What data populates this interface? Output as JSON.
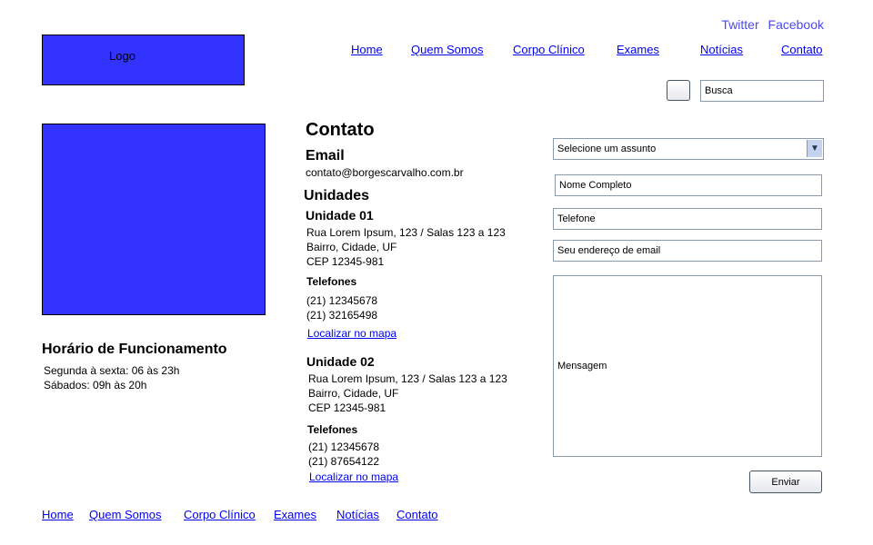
{
  "social": {
    "twitter": "Twitter",
    "facebook": "Facebook"
  },
  "logo": {
    "label": "Logo"
  },
  "nav": [
    "Home",
    "Quem Somos",
    "Corpo Clínico",
    "Exames",
    "Notícias",
    "Contato"
  ],
  "search": {
    "placeholder": "Busca"
  },
  "hours": {
    "title": "Horário de Funcionamento",
    "lines": [
      "Segunda à sexta: 06 às 23h",
      "Sábados: 09h às 20h"
    ]
  },
  "contact": {
    "title": "Contato",
    "email_heading": "Email",
    "email": "contato@borgescarvalho.com.br",
    "units_heading": "Unidades",
    "units": [
      {
        "name": "Unidade 01",
        "address": [
          "Rua Lorem Ipsum, 123 / Salas 123 a 123",
          "Bairro, Cidade, UF",
          "CEP 12345-981"
        ],
        "phones_label": "Telefones",
        "phones": [
          "(21) 12345678",
          "(21) 32165498"
        ],
        "map_link": "Localizar no mapa"
      },
      {
        "name": "Unidade 02",
        "address": [
          "Rua Lorem Ipsum, 123 / Salas 123 a 123",
          "Bairro, Cidade, UF",
          "CEP 12345-981"
        ],
        "phones_label": "Telefones",
        "phones": [
          "(21) 12345678",
          "(21) 87654122"
        ],
        "map_link": "Localizar no mapa"
      }
    ]
  },
  "form": {
    "subject": "Selecione um assunto",
    "name": "Nome Completo",
    "phone": "Telefone",
    "email": "Seu endereço de email",
    "message": "Mensagem",
    "submit": "Enviar"
  },
  "footer_nav": [
    "Home",
    "Quem Somos",
    "Corpo Clínico",
    "Exames",
    "Notícias",
    "Contato"
  ]
}
